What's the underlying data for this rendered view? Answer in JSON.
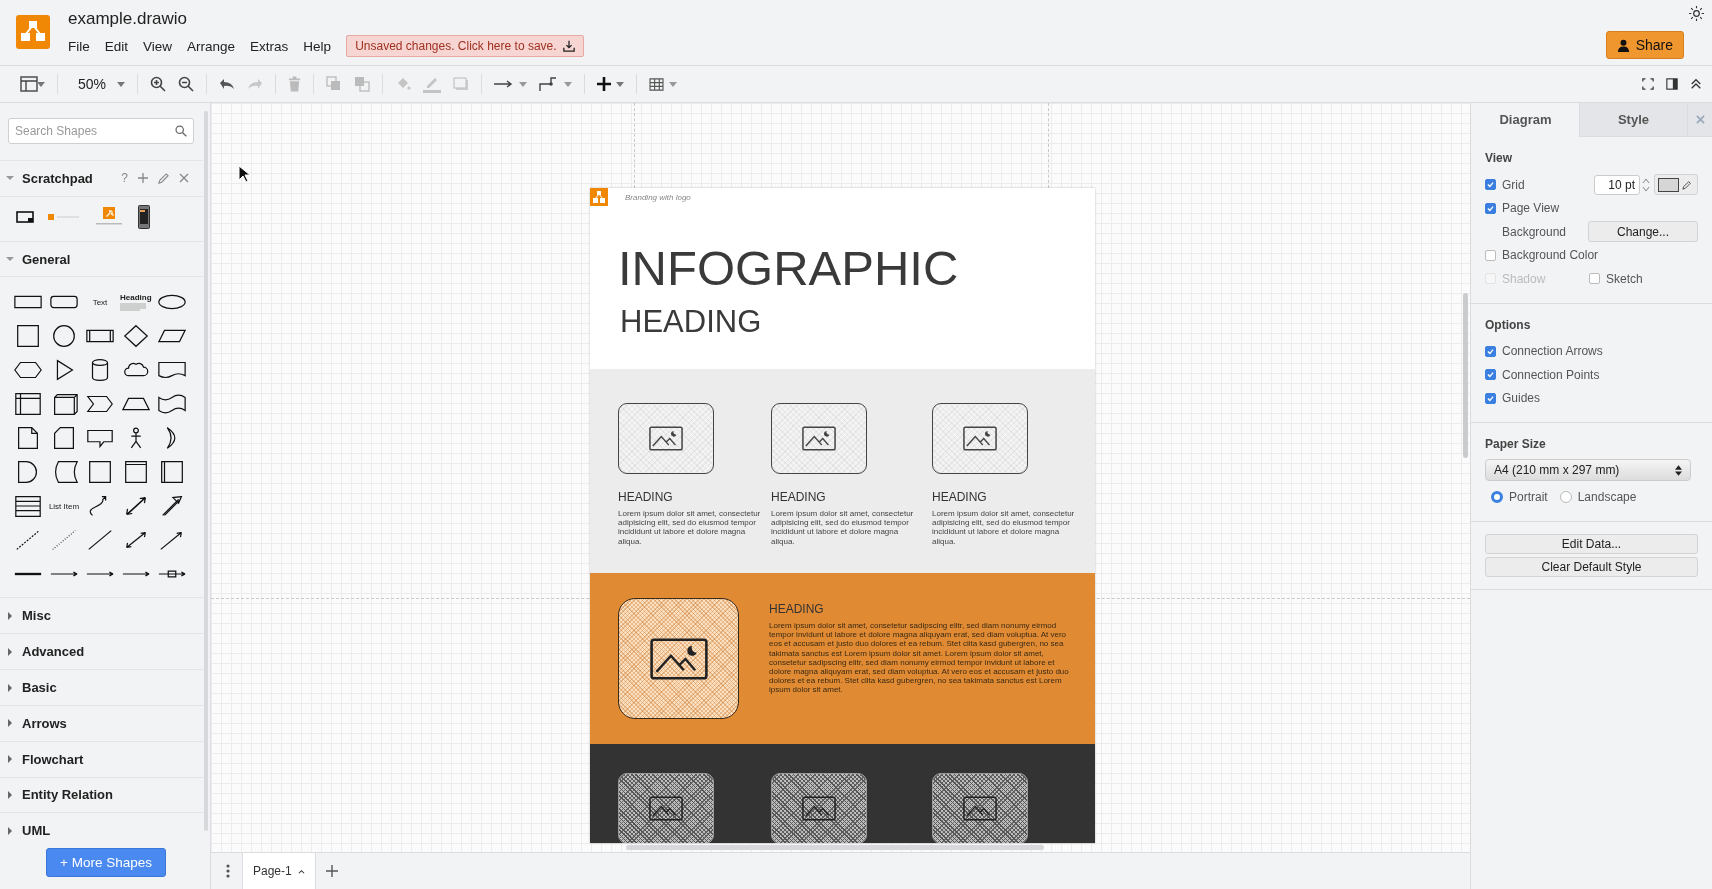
{
  "header": {
    "title": "example.drawio",
    "menu": [
      "File",
      "Edit",
      "View",
      "Arrange",
      "Extras",
      "Help"
    ],
    "notice": "Unsaved changes. Click here to save.",
    "share": "Share"
  },
  "toolbar": {
    "zoom": "50%"
  },
  "sidebar": {
    "search": {
      "placeholder": "Search Shapes"
    },
    "sections": [
      {
        "kind": "scratchpad",
        "title": "Scratchpad",
        "expanded": true,
        "help": "?",
        "items": [
          {
            "kind": "frame"
          },
          {
            "kind": "banner"
          },
          {
            "kind": "logo"
          },
          {
            "kind": "phone"
          }
        ]
      },
      {
        "kind": "palette",
        "title": "General",
        "expanded": true,
        "shapes": [
          {
            "kind": "rect"
          },
          {
            "kind": "rounded"
          },
          {
            "kind": "text",
            "label": "Text"
          },
          {
            "kind": "heading",
            "label": "Heading"
          },
          {
            "kind": "ellipse"
          },
          {
            "kind": "square"
          },
          {
            "kind": "circle"
          },
          {
            "kind": "process"
          },
          {
            "kind": "diamond"
          },
          {
            "kind": "parallelogram"
          },
          {
            "kind": "hexagon"
          },
          {
            "kind": "triangle"
          },
          {
            "kind": "cylinder"
          },
          {
            "kind": "cloud"
          },
          {
            "kind": "document"
          },
          {
            "kind": "storage"
          },
          {
            "kind": "cube"
          },
          {
            "kind": "step"
          },
          {
            "kind": "trapezoid"
          },
          {
            "kind": "tape"
          },
          {
            "kind": "note"
          },
          {
            "kind": "card"
          },
          {
            "kind": "callout"
          },
          {
            "kind": "actor"
          },
          {
            "kind": "crescent"
          },
          {
            "kind": "delay"
          },
          {
            "kind": "datastore"
          },
          {
            "kind": "container"
          },
          {
            "kind": "headed"
          },
          {
            "kind": "swimlane"
          },
          {
            "kind": "list"
          },
          {
            "kind": "listitem",
            "label": "List Item"
          },
          {
            "kind": "curved"
          },
          {
            "kind": "blockdouble"
          },
          {
            "kind": "blockarrow"
          },
          {
            "kind": "dashed"
          },
          {
            "kind": "dotted"
          },
          {
            "kind": "line"
          },
          {
            "kind": "biarrow"
          },
          {
            "kind": "arrow"
          },
          {
            "kind": "thick"
          },
          {
            "kind": "connector"
          },
          {
            "kind": "connector"
          },
          {
            "kind": "connector"
          },
          {
            "kind": "boxconnector"
          }
        ]
      },
      {
        "kind": "library",
        "title": "Misc",
        "expanded": false
      },
      {
        "kind": "library",
        "title": "Advanced",
        "expanded": false
      },
      {
        "kind": "library",
        "title": "Basic",
        "expanded": false
      },
      {
        "kind": "library",
        "title": "Arrows",
        "expanded": false
      },
      {
        "kind": "library",
        "title": "Flowchart",
        "expanded": false
      },
      {
        "kind": "library",
        "title": "Entity Relation",
        "expanded": false
      },
      {
        "kind": "library",
        "title": "UML",
        "expanded": false
      }
    ],
    "more_button": "+ More Shapes"
  },
  "diagram": {
    "branding": "Branding with logo",
    "title": "INFOGRAPHIC",
    "subtitle": "HEADING",
    "cards": [
      {
        "heading": "HEADING",
        "text": "Lorem ipsum dolor sit amet, consectetur adipisicing elit, sed do eiusmod tempor incididunt ut labore et dolore magna aliqua."
      },
      {
        "heading": "HEADING",
        "text": "Lorem ipsum dolor sit amet, consectetur adipisicing elit, sed do eiusmod tempor incididunt ut labore et dolore magna aliqua."
      },
      {
        "heading": "HEADING",
        "text": "Lorem ipsum dolor sit amet, consectetur adipisicing elit, sed do eiusmod tempor incididunt ut labore et dolore magna aliqua."
      }
    ],
    "feature": {
      "heading": "HEADING",
      "text": "Lorem ipsum dolor sit amet, consetetur sadipscing elitr, sed diam nonumy eirmod tempor invidunt ut labore et dolore magna aliquyam erat, sed diam voluptua. At vero eos et accusam et justo duo dolores et ea rebum. Stet clita kasd gubergren, no sea takimata sanctus est Lorem ipsum dolor sit amet. Lorem ipsum dolor sit amet, consetetur sadipscing elitr, sed diam nonumy eirmod tempor invidunt ut labore et dolore magna aliquyam erat, sed diam voluptua. At vero eos et accusam et justo duo dolores et ea rebum. Stet clita kasd gubergren, no sea takimata sanctus est Lorem ipsum dolor sit amet."
    }
  },
  "pages": [
    {
      "label": "Page-1",
      "selected": true
    }
  ],
  "format_panel": {
    "tabs": [
      {
        "label": "Diagram",
        "selected": true
      },
      {
        "label": "Style",
        "selected": false
      }
    ],
    "view": {
      "title": "View",
      "grid": {
        "label": "Grid",
        "checked": true,
        "size": "10 pt"
      },
      "page_view": {
        "label": "Page View",
        "checked": true
      },
      "background": {
        "label": "Background",
        "button": "Change..."
      },
      "background_color": {
        "label": "Background Color",
        "checked": false
      },
      "shadow": {
        "label": "Shadow",
        "checked": false,
        "disabled": true
      },
      "sketch": {
        "label": "Sketch",
        "checked": false,
        "disabled": false
      }
    },
    "options": {
      "title": "Options",
      "items": [
        {
          "label": "Connection Arrows",
          "checked": true
        },
        {
          "label": "Connection Points",
          "checked": true
        },
        {
          "label": "Guides",
          "checked": true
        }
      ]
    },
    "paper": {
      "title": "Paper Size",
      "size": "A4 (210 mm x 297 mm)",
      "orientations": [
        {
          "label": "Portrait",
          "selected": true
        },
        {
          "label": "Landscape",
          "selected": false
        }
      ]
    },
    "buttons": [
      "Edit Data...",
      "Clear Default Style"
    ]
  }
}
